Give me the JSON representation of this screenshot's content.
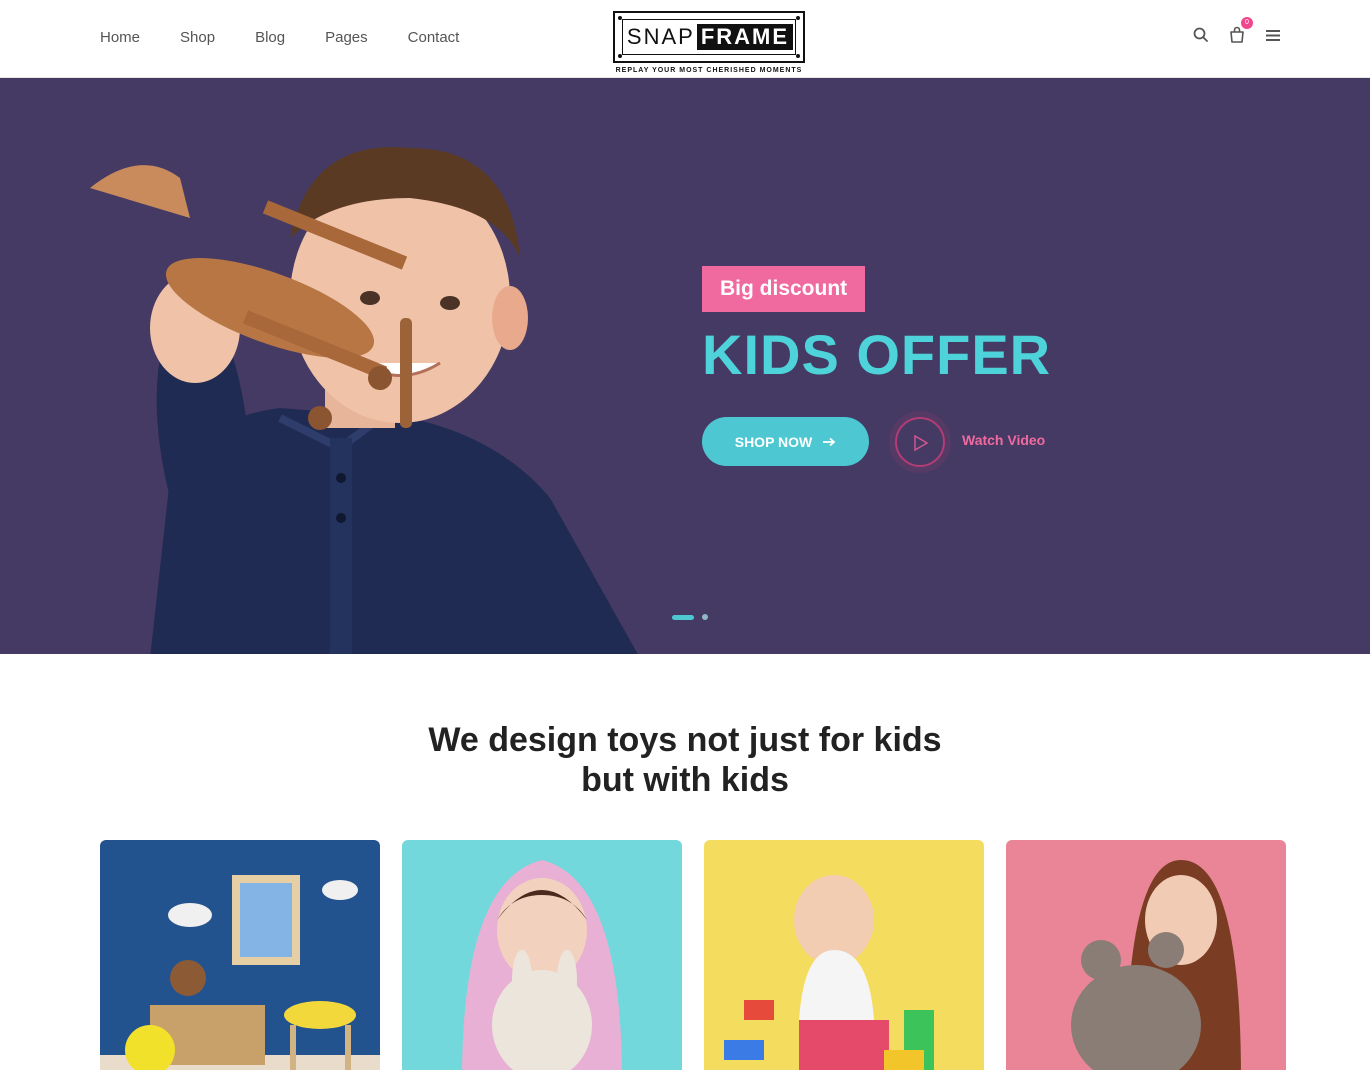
{
  "nav": {
    "items": [
      "Home",
      "Shop",
      "Blog",
      "Pages",
      "Contact"
    ]
  },
  "logo": {
    "snap": "SNAP",
    "frame": "FRAME",
    "tagline": "REPLAY YOUR MOST CHERISHED MOMENTS"
  },
  "header": {
    "cart_count": "0"
  },
  "hero": {
    "badge": "Big discount",
    "title": "KIDS OFFER",
    "shop_button": "SHOP NOW",
    "watch_video": "Watch Video"
  },
  "section": {
    "title_line1": "We design toys not just for kids",
    "title_line2": "but with kids"
  },
  "colors": {
    "hero_bg": "#453a63",
    "accent_teal": "#4dc8d2",
    "accent_pink": "#f06aa0"
  },
  "icons": [
    "search-icon",
    "cart-icon",
    "menu-icon",
    "play-icon",
    "arrow-right-icon"
  ]
}
